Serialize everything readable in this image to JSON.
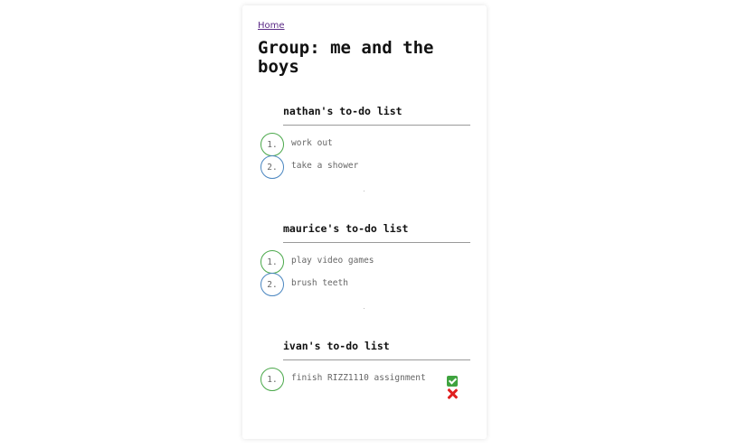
{
  "nav": {
    "home_label": "Home"
  },
  "page": {
    "title": "Group: me and the boys"
  },
  "lists": [
    {
      "title": "nathan's to-do list",
      "items": [
        {
          "number": "1.",
          "text": "work out",
          "ring_color": "#4aa84a"
        },
        {
          "number": "2.",
          "text": "take a shower",
          "ring_color": "#4a86c0"
        }
      ]
    },
    {
      "title": "maurice's to-do list",
      "items": [
        {
          "number": "1.",
          "text": "play video games",
          "ring_color": "#4aa84a"
        },
        {
          "number": "2.",
          "text": "brush teeth",
          "ring_color": "#4a86c0"
        }
      ]
    },
    {
      "title": "ivan's to-do list",
      "items": [
        {
          "number": "1.",
          "text": "finish RIZZ1110 assignment",
          "ring_color": "#4aa84a",
          "actions": [
            "check-icon",
            "x-icon"
          ]
        }
      ]
    }
  ]
}
